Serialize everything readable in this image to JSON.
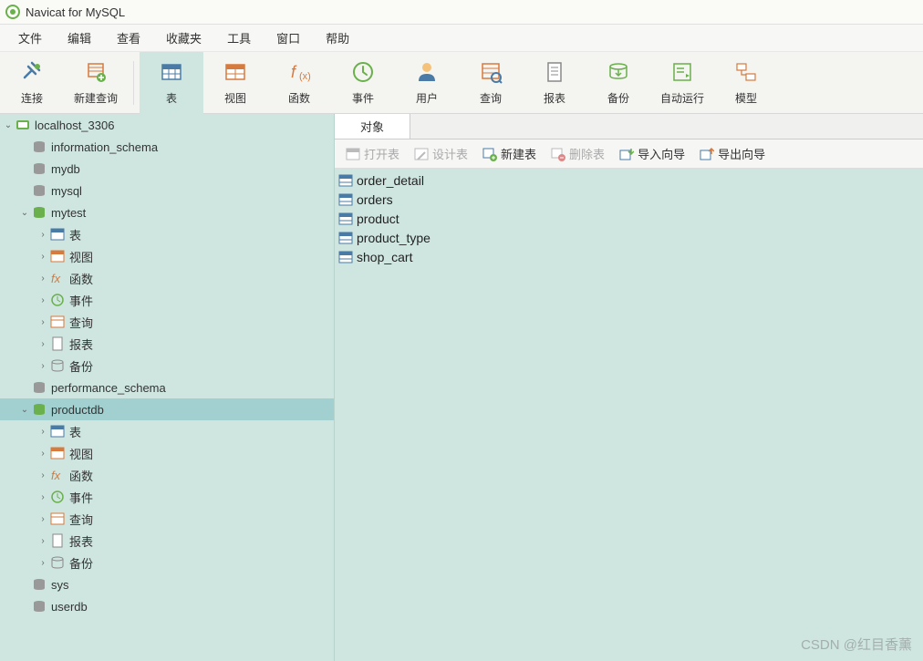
{
  "title": "Navicat for MySQL",
  "menu": [
    "文件",
    "编辑",
    "查看",
    "收藏夹",
    "工具",
    "窗口",
    "帮助"
  ],
  "toolbar": {
    "connect": "连接",
    "newquery": "新建查询",
    "table": "表",
    "view": "视图",
    "function": "函数",
    "event": "事件",
    "user": "用户",
    "query": "查询",
    "report": "报表",
    "backup": "备份",
    "autorun": "自动运行",
    "model": "模型"
  },
  "tree": {
    "conn": "localhost_3306",
    "dbs": {
      "information_schema": "information_schema",
      "mydb": "mydb",
      "mysql": "mysql",
      "mytest": "mytest",
      "performance_schema": "performance_schema",
      "productdb": "productdb",
      "sys": "sys",
      "userdb": "userdb"
    },
    "cats": {
      "table": "表",
      "view": "视图",
      "function": "函数",
      "event": "事件",
      "query": "查询",
      "report": "报表",
      "backup": "备份"
    }
  },
  "tab_object": "对象",
  "subtoolbar": {
    "open": "打开表",
    "design": "设计表",
    "new": "新建表",
    "delete": "删除表",
    "import": "导入向导",
    "export": "导出向导"
  },
  "objects": [
    "order_detail",
    "orders",
    "product",
    "product_type",
    "shop_cart"
  ],
  "watermark": "CSDN @红目香薰"
}
